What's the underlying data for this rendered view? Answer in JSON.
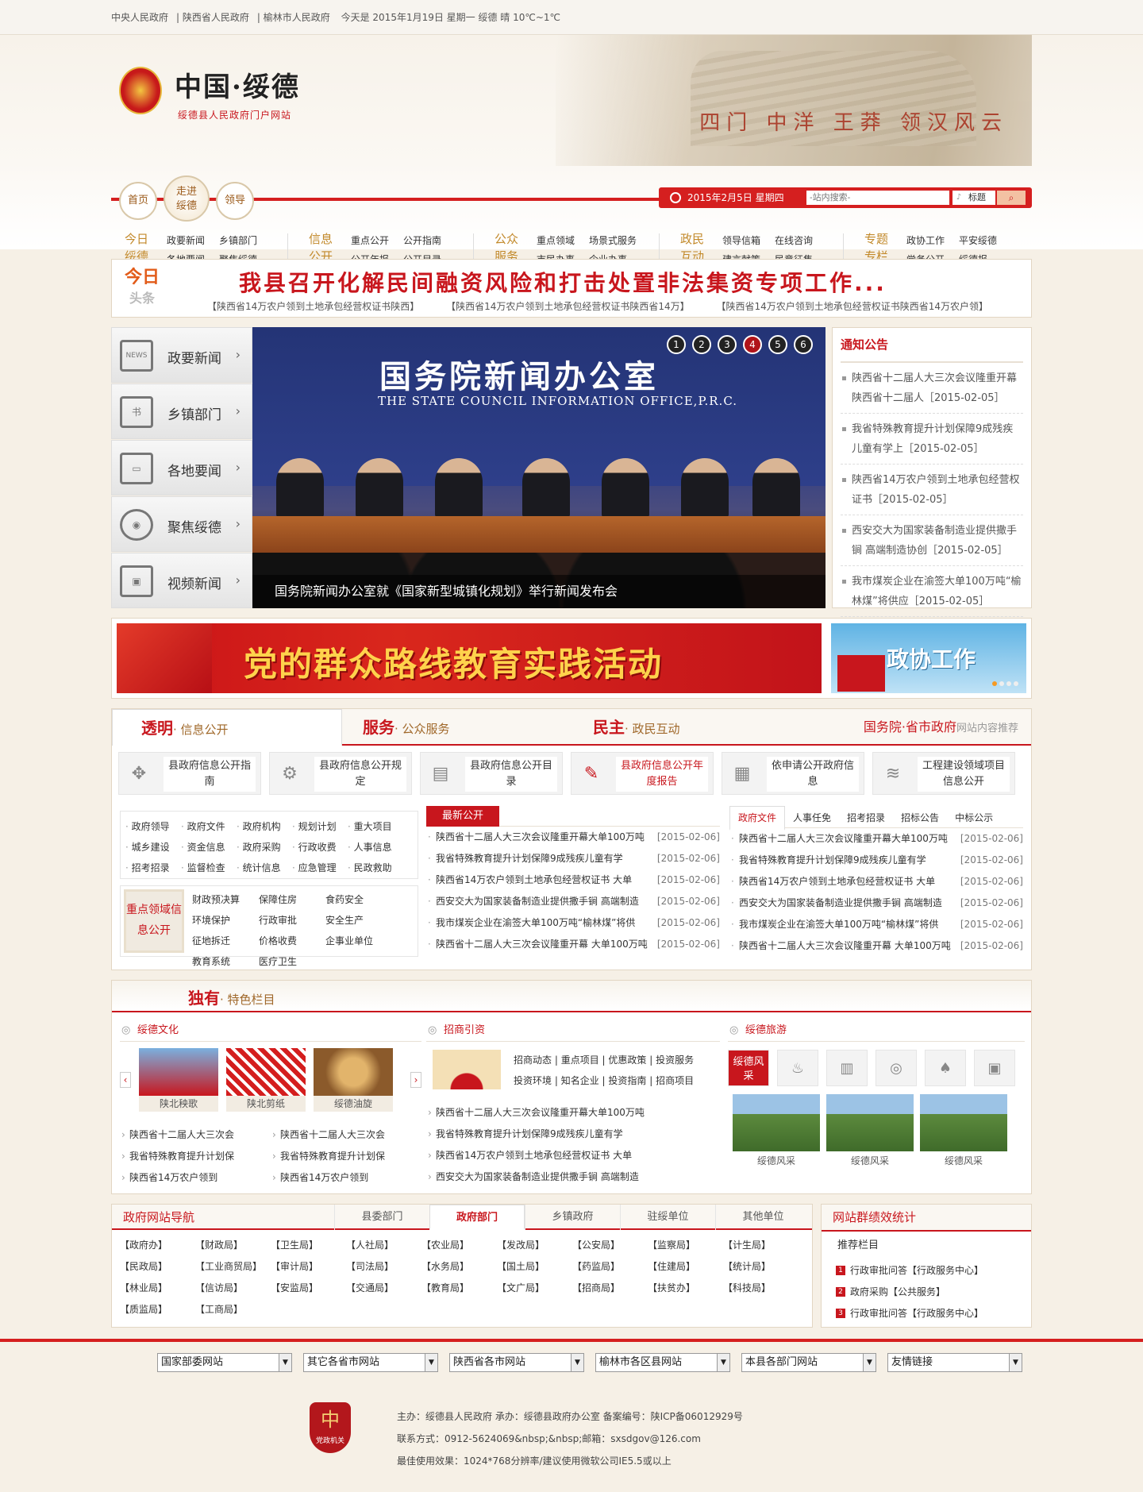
{
  "topbar": {
    "links": [
      "中央人民政府",
      "陕西省人民政府",
      "榆林市人民政府"
    ],
    "today": "今天是 2015年1月19日 星期一 绥德 晴 10℃~1℃"
  },
  "header": {
    "logo_title": "中国·绥德",
    "logo_subtitle": "绥德县人民政府门户网站",
    "scenery_text": "四门 中洋 王莽 领汉风云",
    "circles": [
      "首页",
      "走进绥德",
      "领导"
    ],
    "date": "2015年2月5日 星期四",
    "search_placeholder": "-站内搜索-",
    "search_type": "标题",
    "search_button": "搜索"
  },
  "menu": [
    {
      "head": "今日绥德",
      "links": [
        "政要新闻",
        "乡镇部门",
        "各地要闻",
        "聚焦绥德"
      ]
    },
    {
      "head": "信息公开",
      "links": [
        "重点公开",
        "公开指南",
        "公开年报",
        "公开目录"
      ]
    },
    {
      "head": "公众服务",
      "links": [
        "重点领域",
        "场景式服务",
        "市民办事",
        "企业办事"
      ]
    },
    {
      "head": "政民互动",
      "links": [
        "领导信箱",
        "在线咨询",
        "建言献策",
        "民意征集"
      ]
    },
    {
      "head": "专题专栏",
      "links": [
        "政协工作",
        "平安绥德",
        "党务公开",
        "绥德报"
      ]
    }
  ],
  "headline": {
    "tag_top": "今日",
    "tag_bottom": "头条",
    "title": "我县召开化解民间融资风险和打击处置非法集资专项工作...",
    "subs": [
      "【陕西省14万农户领到土地承包经营权证书陕西】",
      "【陕西省14万农户领到土地承包经营权证书陕西省14万】",
      "【陕西省14万农户领到土地承包经营权证书陕西省14万农户领】"
    ]
  },
  "leftnav": [
    {
      "label": "政要新闻",
      "icon": "NEWS"
    },
    {
      "label": "乡镇部门",
      "icon": "书"
    },
    {
      "label": "各地要闻",
      "icon": "▭"
    },
    {
      "label": "聚焦绥德",
      "icon": "◉"
    },
    {
      "label": "视频新闻",
      "icon": "▣"
    }
  ],
  "slider": {
    "sign_cn": "国务院新闻办公室",
    "sign_en": "THE STATE COUNCIL INFORMATION OFFICE,P.R.C.",
    "caption": "国务院新闻办公室就《国家新型城镇化规划》举行新闻发布会",
    "pages": [
      "1",
      "2",
      "3",
      "4",
      "5",
      "6"
    ],
    "active_page": 4
  },
  "notice": {
    "title": "通知公告",
    "items": [
      "陕西省十二届人大三次会议隆重开幕陕西省十二届人［2015-02-05］",
      "我省特殊教育提升计划保障9成残疾儿童有学上［2015-02-05］",
      "陕西省14万农户领到土地承包经营权证书［2015-02-05］",
      "西安交大为国家装备制造业提供撒手锏 高端制造协创［2015-02-05］",
      "我市煤炭企业在渝签大单100万吨“榆林煤”将供应［2015-02-05］"
    ]
  },
  "banner": {
    "main": "党的群众路线教育实践活动",
    "side": "政协工作"
  },
  "info": {
    "tabs": [
      {
        "main": "透明",
        "sub": "· 信息公开"
      },
      {
        "main": "服务",
        "sub": "· 公众服务"
      },
      {
        "main": "民主",
        "sub": "· 政民互动"
      }
    ],
    "right_main": "国务院·省市政府",
    "right_sub": "网站内容推荐",
    "boxes": [
      {
        "icon": "✥",
        "text": "县政府信息公开指南"
      },
      {
        "icon": "⚙",
        "text": "县政府信息公开规定"
      },
      {
        "icon": "▤",
        "text": "县政府信息公开目录"
      },
      {
        "icon": "✎",
        "text": "县政府信息公开年度报告"
      },
      {
        "icon": "▦",
        "text": "依申请公开政府信息"
      },
      {
        "icon": "≋",
        "text": "工程建设领域项目信息公开"
      }
    ],
    "links": [
      "政府领导",
      "政府文件",
      "政府机构",
      "规划计划",
      "重大项目",
      "城乡建设",
      "资金信息",
      "政府采购",
      "行政收费",
      "人事信息",
      "招考招录",
      "监督检查",
      "统计信息",
      "应急管理",
      "民政救助"
    ],
    "focus_label": "重点领域信息公开",
    "focus_links": [
      "财政预决算",
      "保障住房",
      "食药安全",
      "环境保护",
      "行政审批",
      "安全生产",
      "征地拆迁",
      "价格收费",
      "企事业单位",
      "教育系统",
      "医疗卫生"
    ],
    "newpub_title": "最新公开",
    "newpub": [
      {
        "t": "陕西省十二届人大三次会议隆重开幕大单100万吨",
        "d": "[2015-02-06]"
      },
      {
        "t": "我省特殊教育提升计划保障9成残疾儿童有学",
        "d": "[2015-02-06]"
      },
      {
        "t": "陕西省14万农户领到土地承包经营权证书 大单",
        "d": "[2015-02-06]"
      },
      {
        "t": "西安交大为国家装备制造业提供撒手锏 高端制造",
        "d": "[2015-02-06]"
      },
      {
        "t": "我市煤炭企业在渝签大单100万吨“榆林煤”将供",
        "d": "[2015-02-06]"
      },
      {
        "t": "陕西省十二届人大三次会议隆重开幕 大单100万吨",
        "d": "[2015-02-06]"
      }
    ],
    "doc_tabs": [
      "政府文件",
      "人事任免",
      "招考招录",
      "招标公告",
      "中标公示"
    ],
    "docs": [
      {
        "t": "陕西省十二届人大三次会议隆重开幕大单100万吨",
        "d": "[2015-02-06]"
      },
      {
        "t": "我省特殊教育提升计划保障9成残疾儿童有学",
        "d": "[2015-02-06]"
      },
      {
        "t": "陕西省14万农户领到土地承包经营权证书 大单",
        "d": "[2015-02-06]"
      },
      {
        "t": "西安交大为国家装备制造业提供撒手锏 高端制造",
        "d": "[2015-02-06]"
      },
      {
        "t": "我市煤炭企业在渝签大单100万吨“榆林煤”将供",
        "d": "[2015-02-06]"
      },
      {
        "t": "陕西省十二届人大三次会议隆重开幕 大单100万吨",
        "d": "[2015-02-06]"
      }
    ]
  },
  "special": {
    "title_main": "独有",
    "title_sub": "· 特色栏目",
    "culture": {
      "title": "绥德文化",
      "thumbs": [
        "陕北秧歌",
        "陕北剪纸",
        "绥德油旋"
      ],
      "items": [
        "陕西省十二届人大三次会",
        "陕西省十二届人大三次会",
        "我省特殊教育提升计划保",
        "我省特殊教育提升计划保",
        "陕西省14万农户领到",
        "陕西省14万农户领到"
      ]
    },
    "invest": {
      "title": "招商引资",
      "links1": [
        "招商动态",
        "重点项目",
        "优惠政策",
        "投资服务"
      ],
      "links2": [
        "投资环境",
        "知名企业",
        "投资指南",
        "招商项目"
      ],
      "items": [
        "陕西省十二届人大三次会议隆重开幕大单100万吨",
        "我省特殊教育提升计划保障9成残疾儿童有学",
        "陕西省14万农户领到土地承包经营权证书 大单",
        "西安交大为国家装备制造业提供撒手锏 高端制造"
      ]
    },
    "travel": {
      "title": "绥德旅游",
      "first": "绥德风采",
      "icons": [
        "♨",
        "▥",
        "◎",
        "♠",
        "▣"
      ],
      "scenes": [
        "绥德风采",
        "绥德风采",
        "绥德风采"
      ]
    }
  },
  "govnav": {
    "title": "政府网站导航",
    "tabs": [
      "县委部门",
      "政府部门",
      "乡镇政府",
      "驻绥单位",
      "其他单位"
    ],
    "active": "政府部门",
    "items": [
      "【政府办】",
      "【财政局】",
      "【卫生局】",
      "【人社局】",
      "【农业局】",
      "【发改局】",
      "【公安局】",
      "【监察局】",
      "【计生局】",
      "【民政局】",
      "【工业商贸局】",
      "【审计局】",
      "【司法局】",
      "【水务局】",
      "【国土局】",
      "【药监局】",
      "【住建局】",
      "【统计局】",
      "【林业局】",
      "【信访局】",
      "【安监局】",
      "【交通局】",
      "【教育局】",
      "【文广局】",
      "【招商局】",
      "【扶贫办】",
      "【科技局】",
      "【质监局】",
      "【工商局】"
    ]
  },
  "stat": {
    "title": "网站群绩效统计",
    "sub": "推荐栏目",
    "items": [
      "行政审批问答【行政服务中心】",
      "政府采购【公共服务】",
      "行政审批问答【行政服务中心】"
    ]
  },
  "selects": [
    "国家部委网站",
    "其它各省市网站",
    "陕西省各市网站",
    "榆林市各区县网站",
    "本县各部门网站",
    "友情链接"
  ],
  "footer": {
    "emblem": "党政机关",
    "line1": "主办：绥德县人民政府   承办：绥德县政府办公室 备案编号：陕ICP备06012929号",
    "line2": "联系方式：0912-5624069&nbsp;&nbsp;邮箱：sxsdgov@126.com",
    "line3": "最佳使用效果：1024*768分辨率/建议使用微软公司IE5.5或以上"
  },
  "colors": {
    "brand_red": "#c8161d",
    "accent_gold": "#c2892a"
  }
}
